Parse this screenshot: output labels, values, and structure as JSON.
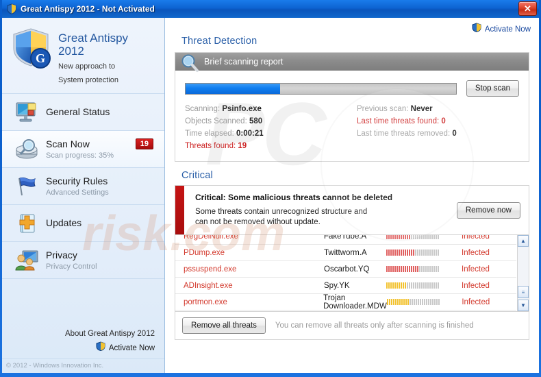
{
  "window": {
    "title": "Great Antispy 2012 - Not Activated",
    "close_label": "✕",
    "titlebar_color": "#0d63d2"
  },
  "sidebar": {
    "brand": {
      "name_line1": "Great Antispy",
      "name_line2": "2012",
      "tagline_line1": "New approach to",
      "tagline_line2": "System protection",
      "logo_icon": "shield-icon"
    },
    "items": [
      {
        "title": "General Status",
        "sub": "",
        "badge": "",
        "icon": "monitor-icon",
        "active": false
      },
      {
        "title": "Scan Now",
        "sub": "Scan progress: 35%",
        "badge": "19",
        "icon": "scan-magnifier-icon",
        "active": true
      },
      {
        "title": "Security Rules",
        "sub": "Advanced Settings",
        "badge": "",
        "icon": "flag-icon",
        "active": false
      },
      {
        "title": "Updates",
        "sub": "",
        "badge": "",
        "icon": "updates-icon",
        "active": false
      },
      {
        "title": "Privacy",
        "sub": "Privacy Control",
        "badge": "",
        "icon": "privacy-users-icon",
        "active": false
      }
    ],
    "about_label": "About Great Antispy 2012",
    "activate_label": "Activate Now",
    "copyright": "© 2012 - Windows Innovation Inc."
  },
  "main": {
    "activate_top_label": "Activate Now",
    "threat_detection_heading": "Threat Detection",
    "report": {
      "panel_title": "Brief scanning report",
      "progress_percent": 35,
      "stop_scan_label": "Stop scan",
      "stats_left": [
        {
          "label": "Scanning:",
          "value": "Psinfo.exe",
          "style": "normal"
        },
        {
          "label": "Objects Scanned:",
          "value": "580",
          "style": "normal"
        },
        {
          "label": "Time elapsed:",
          "value": "0:00:21",
          "style": "normal"
        },
        {
          "label": "Threats found:",
          "value": "19",
          "style": "red"
        }
      ],
      "stats_right": [
        {
          "label": "Previous scan:",
          "value": "Never",
          "style": "normal"
        },
        {
          "label": "Last time threats found:",
          "value": "0",
          "style": "red"
        },
        {
          "label": "Last time threats removed:",
          "value": "0",
          "style": "normal"
        }
      ]
    },
    "critical": {
      "heading": "Critical",
      "title": "Critical: Some malicious threats cannot be deleted",
      "desc_line1": "Some threats contain unrecognized structure and",
      "desc_line2": "can not be removed without update.",
      "remove_now_label": "Remove now",
      "stripe_color": "#c51414"
    },
    "threat_list": {
      "rows": [
        {
          "file": "RegDelNull.exe",
          "threat": "FakeTube.A",
          "severity": 12,
          "severity_color": "#e06060",
          "status": "Infected"
        },
        {
          "file": "PDump.exe",
          "threat": "Twittworm.A",
          "severity": 14,
          "severity_color": "#e06060",
          "status": "Infected"
        },
        {
          "file": "pssuspend.exe",
          "threat": "Oscarbot.YQ",
          "severity": 16,
          "severity_color": "#e06060",
          "status": "Infected"
        },
        {
          "file": "ADInsight.exe",
          "threat": "Spy.YK",
          "severity": 10,
          "severity_color": "#f2c230",
          "status": "Infected"
        },
        {
          "file": "portmon.exe",
          "threat": "Trojan Downloader.MDW",
          "severity": 11,
          "severity_color": "#f2c230",
          "status": "Infected"
        }
      ],
      "severity_total": 26,
      "scroll_up": "▲",
      "scroll_down": "▼"
    },
    "footer": {
      "remove_all_label": "Remove all threats",
      "note": "You can remove all threats only after scanning is finished"
    }
  },
  "watermark": {
    "big": "PC",
    "sub": "risk.com"
  }
}
